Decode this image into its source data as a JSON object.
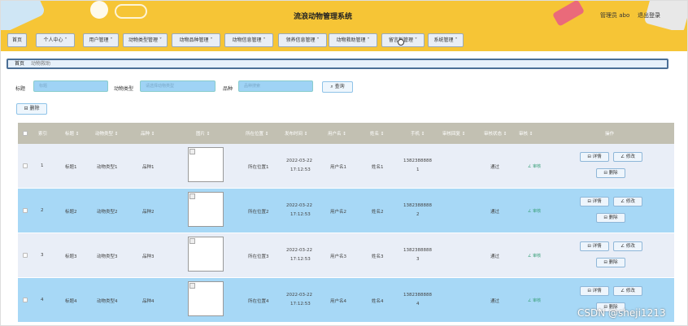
{
  "header": {
    "title": "流浪动物管理系统",
    "user": "管理员 abo",
    "logout": "退出登录"
  },
  "nav": [
    {
      "label": "首页"
    },
    {
      "label": "个人中心 ˅"
    },
    {
      "label": "用户管理 ˅"
    },
    {
      "label": "动物类型管理 ˅"
    },
    {
      "label": "动物品种管理 ˅"
    },
    {
      "label": "动物信息管理 ˅"
    },
    {
      "label": "领养信息管理 ˅"
    },
    {
      "label": "动物救助管理 ˅"
    },
    {
      "label": "留言板管理 ˅"
    },
    {
      "label": "系统管理 ˅"
    }
  ],
  "breadcrumb": {
    "home": "首页",
    "current": "动物救助"
  },
  "search": {
    "title_label": "标题",
    "title_placeholder": "标题",
    "type_label": "动物类型",
    "type_placeholder": "请选择动物类型",
    "breed_label": "品种",
    "breed_placeholder": "品种搜索",
    "query_button": "⌕ 查询"
  },
  "delete_button": "⊟ 删除",
  "table": {
    "headers": [
      "索引",
      "标题 ↕",
      "动物类型 ↕",
      "品种 ↕",
      "图片 ↕",
      "所在位置 ↕",
      "发布时间 ↕",
      "用户名 ↕",
      "姓名 ↕",
      "手机 ↕",
      "审核回复 ↕",
      "审核状态 ↕",
      "审核 ↕",
      "操作"
    ],
    "rows": [
      {
        "idx": "1",
        "title": "标题1",
        "type": "动物类型1",
        "breed": "品种1",
        "loc": "所在位置1",
        "date": "2022-03-22",
        "time": "17:12:53",
        "user": "用户名1",
        "name": "姓名1",
        "phone1": "1382388888",
        "phone2": "1",
        "status": "通过",
        "audit": "∠ 审核"
      },
      {
        "idx": "2",
        "title": "标题2",
        "type": "动物类型2",
        "breed": "品种2",
        "loc": "所在位置2",
        "date": "2022-03-22",
        "time": "17:12:53",
        "user": "用户名2",
        "name": "姓名2",
        "phone1": "1382388888",
        "phone2": "2",
        "status": "通过",
        "audit": "∠ 审核"
      },
      {
        "idx": "3",
        "title": "标题3",
        "type": "动物类型3",
        "breed": "品种3",
        "loc": "所在位置3",
        "date": "2022-03-22",
        "time": "17:12:53",
        "user": "用户名3",
        "name": "姓名3",
        "phone1": "1382388888",
        "phone2": "3",
        "status": "通过",
        "audit": "∠ 审核"
      },
      {
        "idx": "4",
        "title": "标题4",
        "type": "动物类型4",
        "breed": "品种4",
        "loc": "所在位置4",
        "date": "2022-03-22",
        "time": "17:12:53",
        "user": "用户名4",
        "name": "姓名4",
        "phone1": "1382388888",
        "phone2": "4",
        "status": "通过",
        "audit": "∠ 审核"
      }
    ],
    "actions": {
      "detail": "⊟ 详情",
      "edit": "∠ 修改",
      "delete": "⊟ 删除"
    }
  },
  "watermark": "CSDN @sheji1213"
}
